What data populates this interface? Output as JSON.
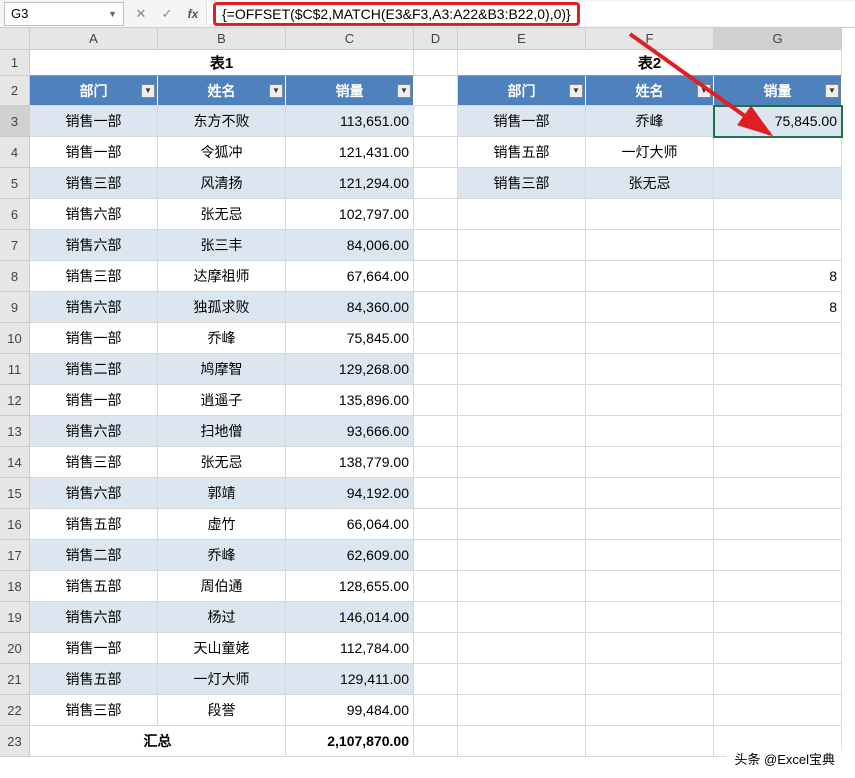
{
  "namebox": "G3",
  "formula": "{=OFFSET($C$2,MATCH(E3&F3,A3:A22&B3:B22,0),0)}",
  "colHeaders": [
    "A",
    "B",
    "C",
    "D",
    "E",
    "F",
    "G"
  ],
  "table1": {
    "title": "表1",
    "headers": [
      "部门",
      "姓名",
      "销量"
    ],
    "rows": [
      {
        "dept": "销售一部",
        "name": "东方不败",
        "val": "113,651.00"
      },
      {
        "dept": "销售一部",
        "name": "令狐冲",
        "val": "121,431.00"
      },
      {
        "dept": "销售三部",
        "name": "风清扬",
        "val": "121,294.00"
      },
      {
        "dept": "销售六部",
        "name": "张无忌",
        "val": "102,797.00"
      },
      {
        "dept": "销售六部",
        "name": "张三丰",
        "val": "84,006.00"
      },
      {
        "dept": "销售三部",
        "name": "达摩祖师",
        "val": "67,664.00"
      },
      {
        "dept": "销售六部",
        "name": "独孤求败",
        "val": "84,360.00"
      },
      {
        "dept": "销售一部",
        "name": "乔峰",
        "val": "75,845.00"
      },
      {
        "dept": "销售二部",
        "name": "鸠摩智",
        "val": "129,268.00"
      },
      {
        "dept": "销售一部",
        "name": "逍遥子",
        "val": "135,896.00"
      },
      {
        "dept": "销售六部",
        "name": "扫地僧",
        "val": "93,666.00"
      },
      {
        "dept": "销售三部",
        "name": "张无忌",
        "val": "138,779.00"
      },
      {
        "dept": "销售六部",
        "name": "郭靖",
        "val": "94,192.00"
      },
      {
        "dept": "销售五部",
        "name": "虚竹",
        "val": "66,064.00"
      },
      {
        "dept": "销售二部",
        "name": "乔峰",
        "val": "62,609.00"
      },
      {
        "dept": "销售五部",
        "name": "周伯通",
        "val": "128,655.00"
      },
      {
        "dept": "销售六部",
        "name": "杨过",
        "val": "146,014.00"
      },
      {
        "dept": "销售一部",
        "name": "天山童姥",
        "val": "112,784.00"
      },
      {
        "dept": "销售五部",
        "name": "一灯大师",
        "val": "129,411.00"
      },
      {
        "dept": "销售三部",
        "name": "段誉",
        "val": "99,484.00"
      }
    ],
    "totalLabel": "汇总",
    "totalVal": "2,107,870.00"
  },
  "table2": {
    "title": "表2",
    "headers": [
      "部门",
      "姓名",
      "销量"
    ],
    "rows": [
      {
        "dept": "销售一部",
        "name": "乔峰",
        "val": "75,845.00"
      },
      {
        "dept": "销售五部",
        "name": "一灯大师",
        "val": ""
      },
      {
        "dept": "销售三部",
        "name": "张无忌",
        "val": ""
      }
    ]
  },
  "extra": {
    "G8": "8",
    "G9": "8"
  },
  "watermark": "头条 @Excel宝典"
}
